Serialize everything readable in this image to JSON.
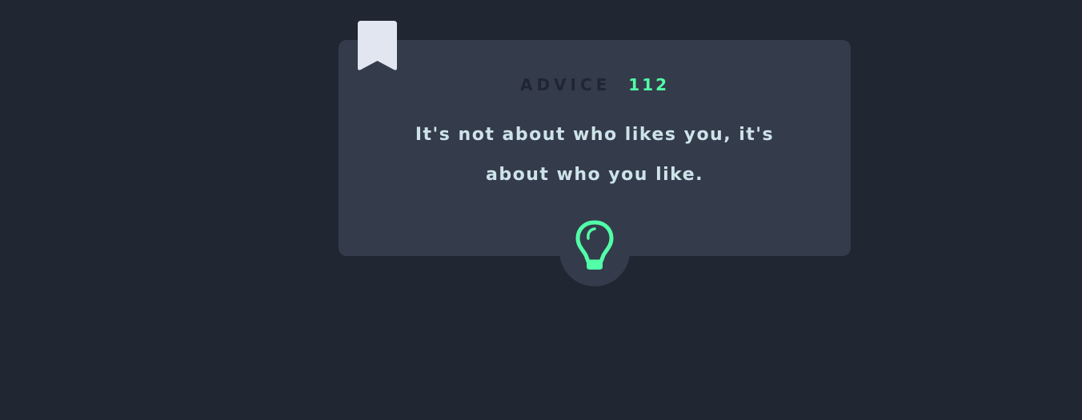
{
  "advice": {
    "label": "ADVICE",
    "number": "112",
    "quote": "It's not about who likes you, it's about who you like."
  },
  "icons": {
    "bookmark": "bookmark-icon",
    "generate": "lightbulb-icon"
  },
  "colors": {
    "background": "#202632",
    "card": "#343b4b",
    "accent": "#52ffa8",
    "quote_text": "#cee3e9",
    "heading_text": "#1f2533",
    "bookmark": "#e1e6f0"
  }
}
